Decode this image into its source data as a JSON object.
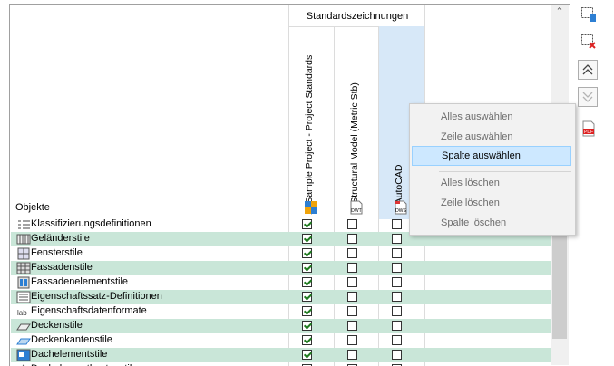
{
  "grid": {
    "group_header": "Standardszeichnungen",
    "objects_label": "Objekte",
    "columns": [
      {
        "label": "1) Sample Project - Project Standards",
        "icon": "project-icon"
      },
      {
        "label": "2) Structural Model (Metric Stb)",
        "icon": "dwt-file-icon",
        "icon_text": "DWT"
      },
      {
        "label": "3) AutoCAD",
        "icon": "dws-file-icon",
        "icon_text": "DWS"
      }
    ],
    "rows": [
      {
        "name": "Klassifizierungsdefinitionen",
        "icon": "classification-icon",
        "highlight": false,
        "checks": [
          true,
          false,
          false
        ]
      },
      {
        "name": "Geländerstile",
        "icon": "railing-icon",
        "highlight": true,
        "checks": [
          true,
          false,
          false
        ]
      },
      {
        "name": "Fensterstile",
        "icon": "window-icon",
        "highlight": false,
        "checks": [
          true,
          false,
          false
        ]
      },
      {
        "name": "Fassadenstile",
        "icon": "curtain-wall-icon",
        "highlight": true,
        "checks": [
          true,
          false,
          false
        ]
      },
      {
        "name": "Fassadenelementstile",
        "icon": "curtain-wall-unit-icon",
        "highlight": false,
        "checks": [
          true,
          false,
          false
        ]
      },
      {
        "name": "Eigenschaftssatz-Definitionen",
        "icon": "property-set-icon",
        "highlight": true,
        "checks": [
          true,
          false,
          false
        ]
      },
      {
        "name": "Eigenschaftsdatenformate",
        "icon": "data-format-icon",
        "highlight": false,
        "checks": [
          true,
          false,
          false
        ]
      },
      {
        "name": "Deckenstile",
        "icon": "slab-icon",
        "highlight": true,
        "checks": [
          true,
          false,
          false
        ]
      },
      {
        "name": "Deckenkantenstile",
        "icon": "slab-edge-icon",
        "highlight": false,
        "checks": [
          true,
          false,
          false
        ]
      },
      {
        "name": "Dachelementstile",
        "icon": "roof-slab-icon",
        "highlight": true,
        "checks": [
          true,
          false,
          false
        ]
      },
      {
        "name": "Dachelementkantenstile",
        "icon": "roof-edge-icon",
        "highlight": false,
        "checks": [
          true,
          false,
          false
        ]
      }
    ],
    "ico_text": {
      "data_format": "lab"
    }
  },
  "menu": {
    "items": [
      {
        "label": "Alles auswählen",
        "enabled": false,
        "active": false
      },
      {
        "label": "Zeile auswählen",
        "enabled": false,
        "active": false
      },
      {
        "label": "Spalte auswählen",
        "enabled": true,
        "active": true
      },
      {
        "label": "Alles löschen",
        "enabled": false,
        "active": false
      },
      {
        "label": "Zeile löschen",
        "enabled": false,
        "active": false
      },
      {
        "label": "Spalte löschen",
        "enabled": false,
        "active": false
      }
    ]
  },
  "toolbar": {
    "buttons": [
      {
        "icon": "select-all-icon"
      },
      {
        "icon": "clear-selection-icon"
      },
      {
        "icon": "move-up-icon"
      },
      {
        "icon": "move-down-icon"
      },
      {
        "icon": "pdf-export-icon",
        "text": "PDF"
      }
    ]
  },
  "scrollbar": {
    "up_glyph": "⌃"
  },
  "colors": {
    "highlight_row": "#c9e6d8",
    "selected_column": "#d7e8f8",
    "menu_active": "#cde8ff",
    "check": "#1f7a1f"
  }
}
